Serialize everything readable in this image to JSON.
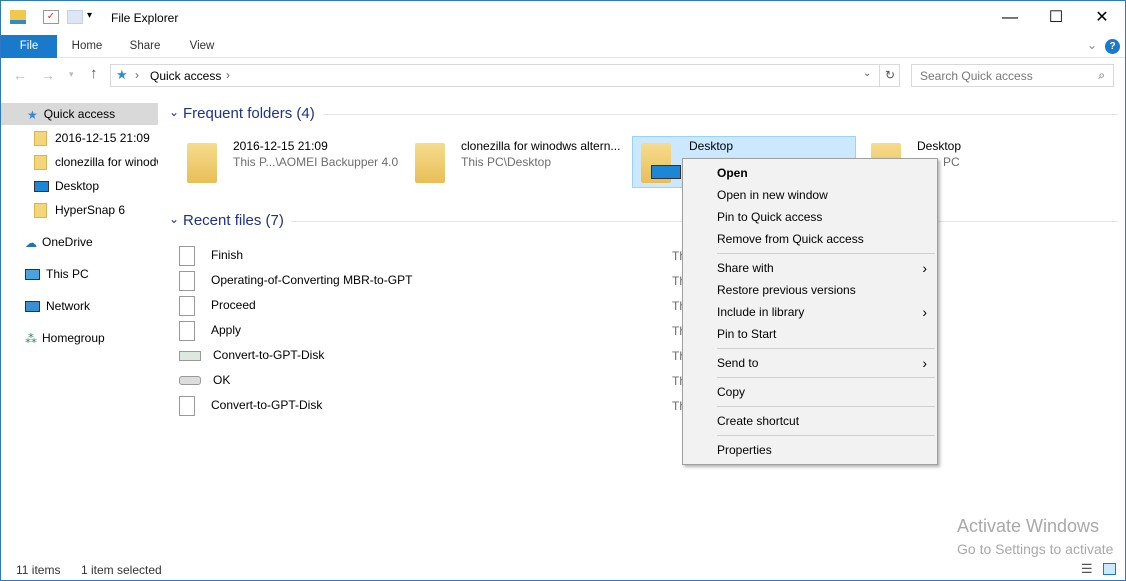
{
  "window": {
    "title": "File Explorer",
    "minimize": "—",
    "maximize": "☐",
    "close": "✕"
  },
  "ribbon": {
    "tabs": [
      "File",
      "Home",
      "Share",
      "View"
    ],
    "help": "?",
    "expand": "⌄"
  },
  "address": {
    "path_root": "Quick access",
    "search_placeholder": "Search Quick access",
    "refresh": "↻"
  },
  "nav": {
    "items": [
      {
        "label": "Quick access",
        "icon": "star-icon"
      },
      {
        "label": "2016-12-15 21:09",
        "icon": "folder-icon"
      },
      {
        "label": "clonezilla for winodws",
        "icon": "folder-icon"
      },
      {
        "label": "Desktop",
        "icon": "desktop-icon"
      },
      {
        "label": "HyperSnap 6",
        "icon": "folder-icon"
      },
      {
        "label": "OneDrive",
        "icon": "cloud-icon"
      },
      {
        "label": "This PC",
        "icon": "computer-icon"
      },
      {
        "label": "Network",
        "icon": "network-icon"
      },
      {
        "label": "Homegroup",
        "icon": "homegroup-icon"
      }
    ]
  },
  "frequent": {
    "header": "Frequent folders (4)",
    "folders": [
      {
        "name": "2016-12-15 21:09",
        "path": "This P...\\AOMEI Backupper 4.0"
      },
      {
        "name": "clonezilla for winodws altern...",
        "path": "This PC\\Desktop"
      },
      {
        "name": "Desktop",
        "path": ""
      },
      {
        "name": "Desktop",
        "path": "PC"
      }
    ]
  },
  "recent": {
    "header": "Recent files (7)",
    "files": [
      {
        "name": "Finish",
        "loc": "Th"
      },
      {
        "name": "Operating-of-Converting MBR-to-GPT",
        "loc": "Th"
      },
      {
        "name": "Proceed",
        "loc": "Th"
      },
      {
        "name": "Apply",
        "loc": "Th"
      },
      {
        "name": "Convert-to-GPT-Disk",
        "loc": "Th"
      },
      {
        "name": "OK",
        "loc": "Th"
      },
      {
        "name": "Convert-to-GPT-Disk",
        "loc": "Th"
      }
    ]
  },
  "context_menu": {
    "items": [
      "Open",
      "Open in new window",
      "Pin to Quick access",
      "Remove from Quick access",
      "Share with",
      "Restore previous versions",
      "Include in library",
      "Pin to Start",
      "Send to",
      "Copy",
      "Create shortcut",
      "Properties"
    ]
  },
  "status": {
    "count": "11 items",
    "selected": "1 item selected"
  },
  "watermark": {
    "line1": "Activate Windows",
    "line2": "Go to Settings to activate"
  }
}
